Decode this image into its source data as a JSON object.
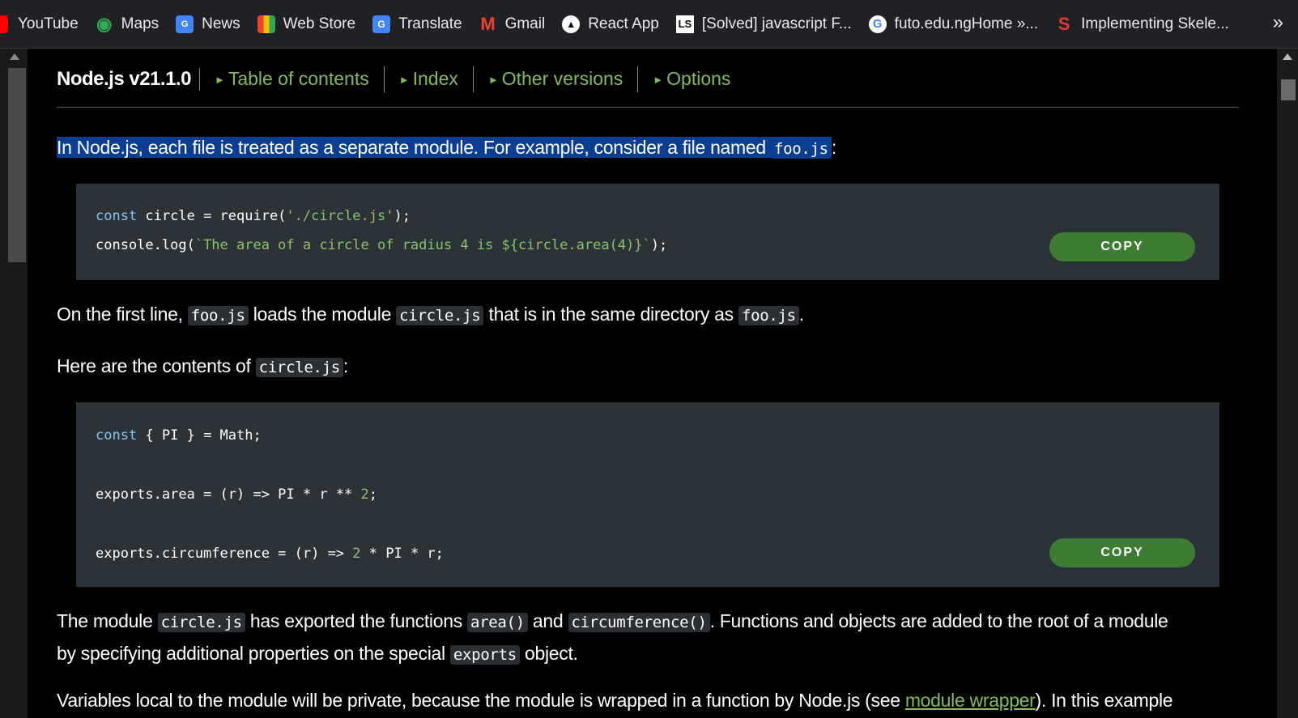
{
  "bookmarks": [
    {
      "label": "YouTube",
      "icon": "youtube-icon",
      "color": "#ff0000"
    },
    {
      "label": "Maps",
      "icon": "maps-icon",
      "color": "#34a853"
    },
    {
      "label": "News",
      "icon": "news-icon",
      "color": "#4285f4"
    },
    {
      "label": "Web Store",
      "icon": "web-store-icon",
      "color": "#ea4335"
    },
    {
      "label": "Translate",
      "icon": "translate-icon",
      "color": "#4285f4"
    },
    {
      "label": "Gmail",
      "icon": "gmail-icon",
      "color": "#ea4335"
    },
    {
      "label": "React App",
      "icon": "react-app-icon",
      "color": "#000000"
    },
    {
      "label": "[Solved] javascript F...",
      "icon": "ls-icon",
      "color": "#ffffff"
    },
    {
      "label": "futo.edu.ngHome »...",
      "icon": "google-icon",
      "color": "#ffffff"
    },
    {
      "label": "Implementing Skele...",
      "icon": "s-icon",
      "color": "#e53935"
    }
  ],
  "bookmarks_more": "»",
  "header": {
    "version": "Node.js v21.1.0",
    "links": [
      "Table of contents",
      "Index",
      "Other versions",
      "Options"
    ]
  },
  "para1": {
    "text": "In Node.js, each file is treated as a separate module. For example, consider a file named ",
    "code": "foo.js",
    "tail": ":"
  },
  "code1": {
    "line1": {
      "kw": "const",
      "a": " circle = require(",
      "str": "'./circle.js'",
      "b": ");"
    },
    "line2": {
      "a": "console.log(",
      "str": "`The area of a circle of radius 4 is ${circle.area(4)}`",
      "b": ");"
    },
    "copy_label": "COPY"
  },
  "para2": {
    "t1": "On the first line, ",
    "c1": "foo.js",
    "t2": " loads the module ",
    "c2": "circle.js",
    "t3": " that is in the same directory as ",
    "c3": "foo.js",
    "t4": "."
  },
  "para3": {
    "t1": "Here are the contents of ",
    "c1": "circle.js",
    "t2": ":"
  },
  "code2": {
    "line1": {
      "kw": "const",
      "a": " { PI } = Math;"
    },
    "line2": {
      "a": "exports.area = (r) => PI * r ** ",
      "num": "2",
      "b": ";"
    },
    "line3": {
      "a": "exports.circumference = (r) => ",
      "num": "2",
      "b": " * PI * r;"
    },
    "copy_label": "COPY"
  },
  "para4": {
    "t1": "The module ",
    "c1": "circle.js",
    "t2": " has exported the functions ",
    "c2": "area()",
    "t3": " and ",
    "c3": "circumference()",
    "t4": ". Functions and objects are added to the root of a module",
    "t5": "by specifying additional properties on the special ",
    "c4": "exports",
    "t6": " object."
  },
  "para5": {
    "t1": "Variables local to the module will be private, because the module is wrapped in a function by Node.js (see ",
    "link": "module wrapper",
    "t2": "). In this example"
  }
}
